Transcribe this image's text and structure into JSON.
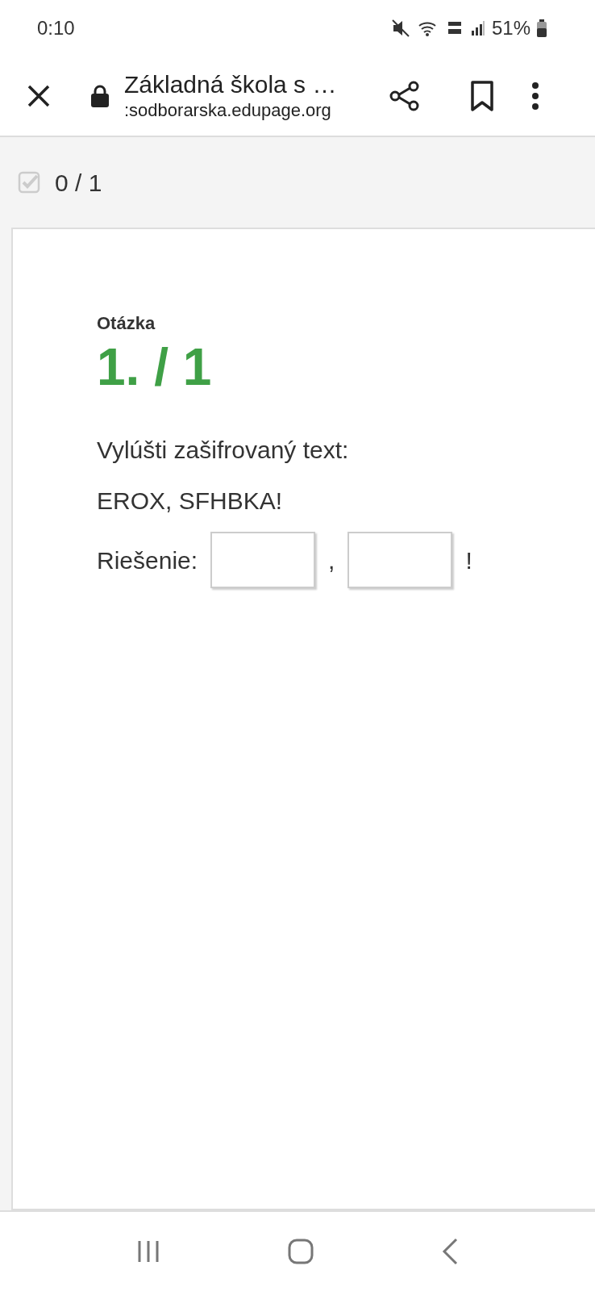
{
  "status_bar": {
    "time": "0:10",
    "battery": "51%"
  },
  "browser_bar": {
    "title": "Základná škola s …",
    "url": ":sodborarska.edupage.org"
  },
  "progress": {
    "text": "0 / 1"
  },
  "question": {
    "label": "Otázka",
    "number": "1. / 1",
    "prompt": "Vylúšti zašifrovaný text:",
    "cipher": "EROX, SFHBKA!",
    "answer": [
      {
        "kind": "text",
        "text": "Riešenie:"
      },
      {
        "kind": "blank"
      },
      {
        "kind": "text",
        "text": ","
      },
      {
        "kind": "blank"
      },
      {
        "kind": "text",
        "text": "!"
      }
    ]
  }
}
